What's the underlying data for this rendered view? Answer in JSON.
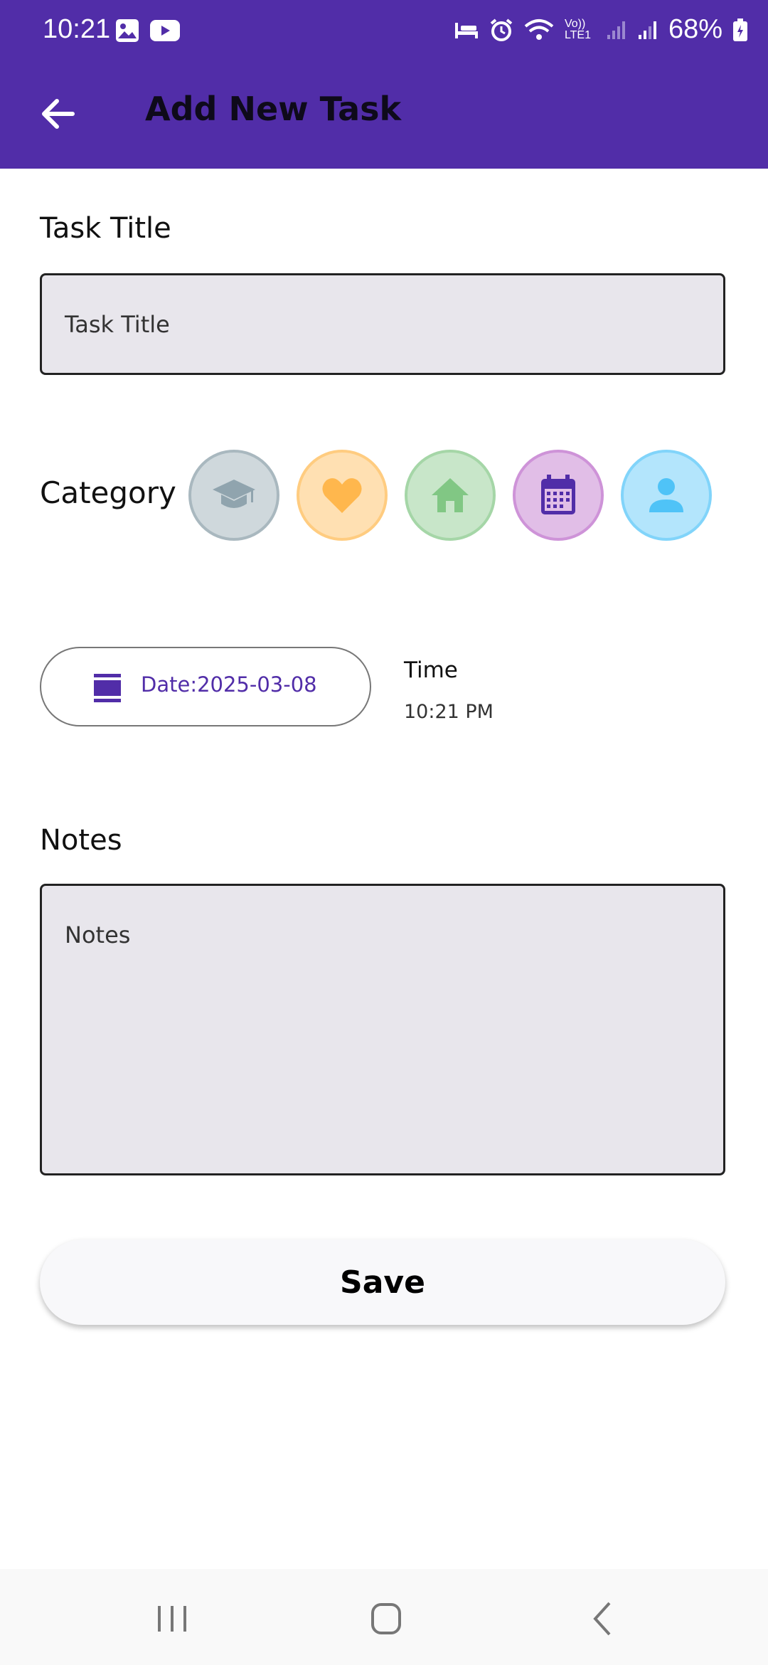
{
  "status_bar": {
    "time": "10:21",
    "battery": "68%",
    "network": "Vo)) LTE1"
  },
  "app_bar": {
    "title": "Add New Task"
  },
  "task_title": {
    "label": "Task Title",
    "placeholder": "Task Title",
    "value": ""
  },
  "category": {
    "label": "Category",
    "options": [
      {
        "icon": "graduation-cap-icon",
        "fill": "#cfd8dc",
        "border": "#a9b8bf",
        "color": "#90a4ae"
      },
      {
        "icon": "heart-icon",
        "fill": "#ffe0b2",
        "border": "#ffcc80",
        "color": "#ffb74d"
      },
      {
        "icon": "home-icon",
        "fill": "#c8e6c9",
        "border": "#a5d6a7",
        "color": "#81c784"
      },
      {
        "icon": "calendar-icon",
        "fill": "#e1bee7",
        "border": "#ce93d8",
        "color": "#512da8"
      },
      {
        "icon": "person-icon",
        "fill": "#b3e5fc",
        "border": "#81d4fa",
        "color": "#4fc3f7"
      }
    ]
  },
  "date": {
    "label": "Date:2025-03-08"
  },
  "time": {
    "label": "Time",
    "value": "10:21 PM"
  },
  "notes": {
    "label": "Notes",
    "placeholder": "Notes",
    "value": ""
  },
  "save": {
    "label": "Save"
  },
  "colors": {
    "primary": "#512da8",
    "field_bg": "#e8e6ec"
  }
}
